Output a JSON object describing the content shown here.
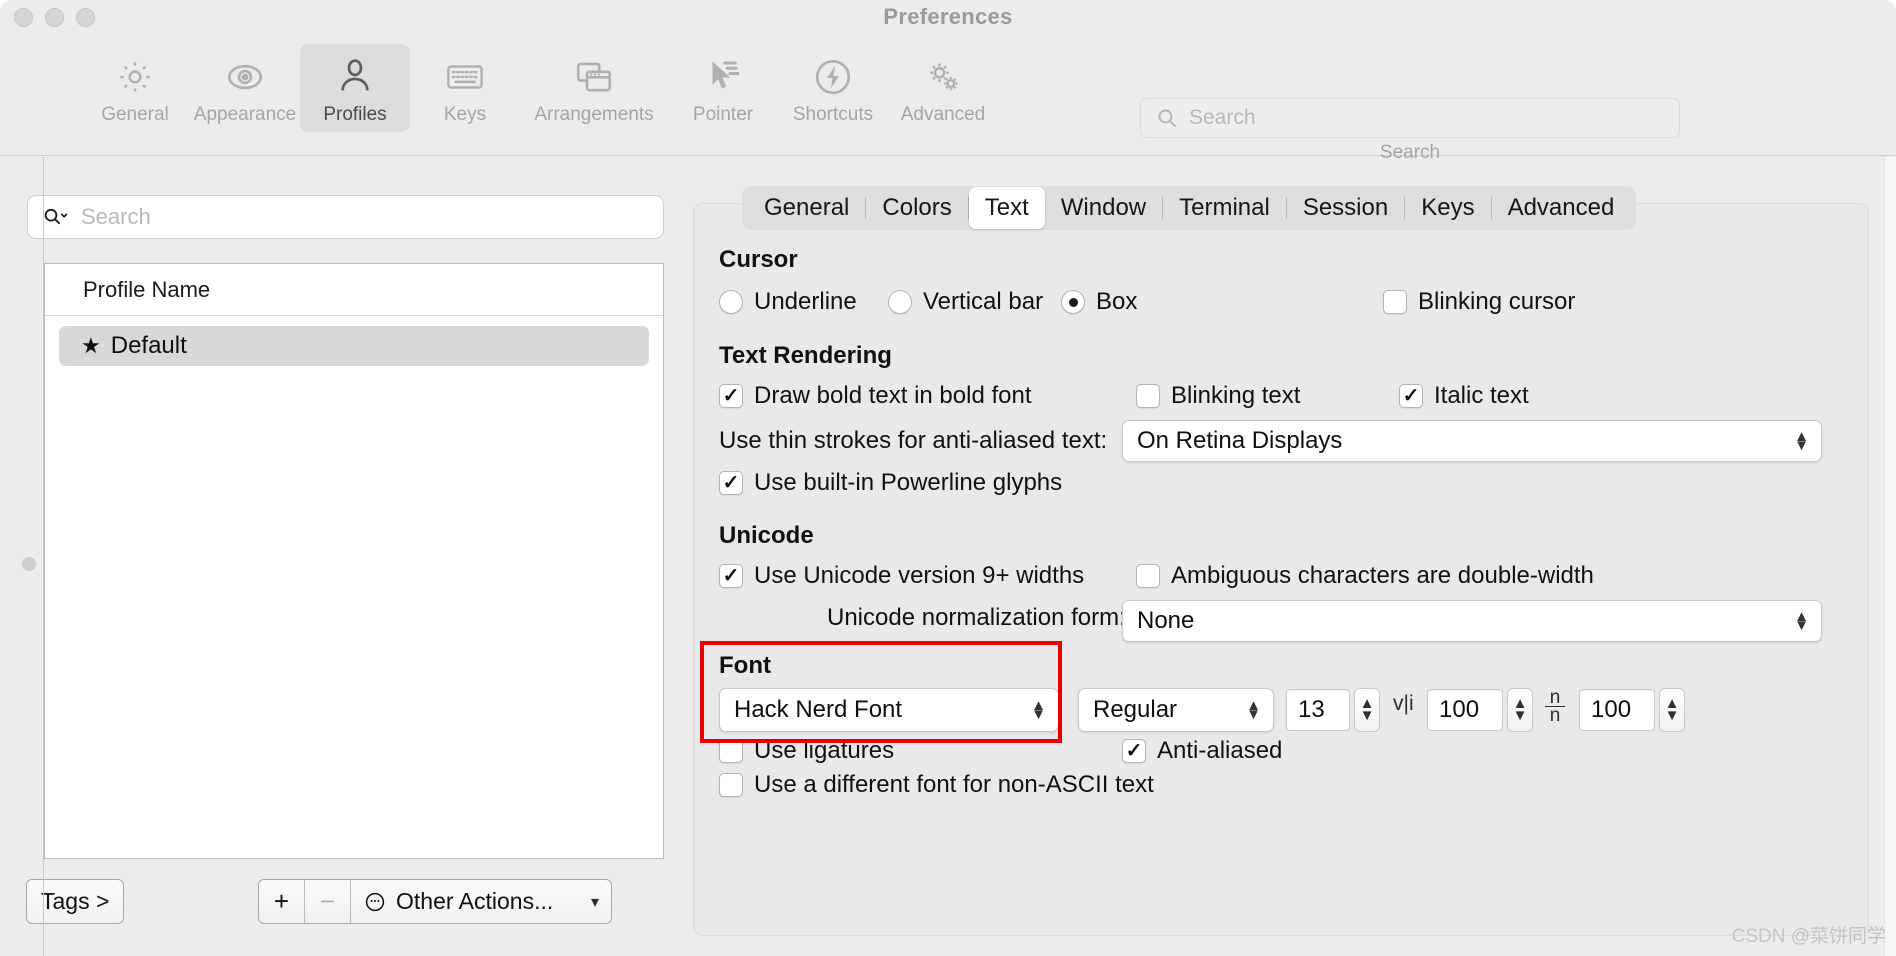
{
  "window": {
    "title": "Preferences",
    "traffic_lights": [
      "close",
      "minimize",
      "zoom"
    ]
  },
  "toolbar": {
    "items": [
      {
        "label": "General",
        "icon": "gear-icon",
        "selected": false
      },
      {
        "label": "Appearance",
        "icon": "eye-icon",
        "selected": false
      },
      {
        "label": "Profiles",
        "icon": "person-icon",
        "selected": true
      },
      {
        "label": "Keys",
        "icon": "keyboard-icon",
        "selected": false
      },
      {
        "label": "Arrangements",
        "icon": "windows-icon",
        "selected": false
      },
      {
        "label": "Pointer",
        "icon": "cursor-icon",
        "selected": false
      },
      {
        "label": "Shortcuts",
        "icon": "bolt-circle-icon",
        "selected": false
      },
      {
        "label": "Advanced",
        "icon": "gears-icon",
        "selected": false
      }
    ],
    "search": {
      "placeholder": "Search",
      "value": "",
      "caption": "Search",
      "icon": "search-icon"
    }
  },
  "sidebar": {
    "search": {
      "placeholder": "Search",
      "value": "",
      "icon": "search-dropdown-icon"
    },
    "profile_table": {
      "column_header": "Profile Name",
      "rows": [
        {
          "name": "Default",
          "badge": "star-icon",
          "selected": true
        }
      ]
    },
    "footer": {
      "tags_button": "Tags >",
      "add_button": "+",
      "remove_button": "−",
      "other_actions": "Other Actions...",
      "other_actions_icon": "ellipsis-circle-icon"
    }
  },
  "tabs": [
    {
      "label": "General",
      "active": false
    },
    {
      "label": "Colors",
      "active": false
    },
    {
      "label": "Text",
      "active": true
    },
    {
      "label": "Window",
      "active": false
    },
    {
      "label": "Terminal",
      "active": false
    },
    {
      "label": "Session",
      "active": false
    },
    {
      "label": "Keys",
      "active": false
    },
    {
      "label": "Advanced",
      "active": false
    }
  ],
  "sections": {
    "cursor": {
      "title": "Cursor",
      "options": [
        {
          "label": "Underline",
          "checked": false
        },
        {
          "label": "Vertical bar",
          "checked": false
        },
        {
          "label": "Box",
          "checked": true
        }
      ],
      "blinking_cursor": {
        "label": "Blinking cursor",
        "checked": false
      }
    },
    "text_rendering": {
      "title": "Text Rendering",
      "draw_bold": {
        "label": "Draw bold text in bold font",
        "checked": true
      },
      "blinking_text": {
        "label": "Blinking text",
        "checked": false
      },
      "italic_text": {
        "label": "Italic text",
        "checked": true
      },
      "thin_strokes": {
        "label": "Use thin strokes for anti-aliased text:",
        "value": "On Retina Displays"
      },
      "powerline": {
        "label": "Use built-in Powerline glyphs",
        "checked": true
      }
    },
    "unicode": {
      "title": "Unicode",
      "version9": {
        "label": "Use Unicode version 9+ widths",
        "checked": true
      },
      "ambiguous": {
        "label": "Ambiguous characters are double-width",
        "checked": false
      },
      "normalization": {
        "label": "Unicode normalization form:",
        "value": "None"
      }
    },
    "font": {
      "title": "Font",
      "family": "Hack Nerd Font",
      "weight": "Regular",
      "size": "13",
      "horizontal_spacing": {
        "icon": "v-bar-i-icon",
        "value": "100"
      },
      "vertical_spacing": {
        "icon": "n-over-n-icon",
        "value": "100"
      },
      "ligatures": {
        "label": "Use ligatures",
        "checked": false
      },
      "anti_aliased": {
        "label": "Anti-aliased",
        "checked": true
      },
      "non_ascii": {
        "label": "Use a different font for non-ASCII text",
        "checked": false
      },
      "highlight_color": "#e60000"
    }
  },
  "watermark": "CSDN @菜饼同学"
}
